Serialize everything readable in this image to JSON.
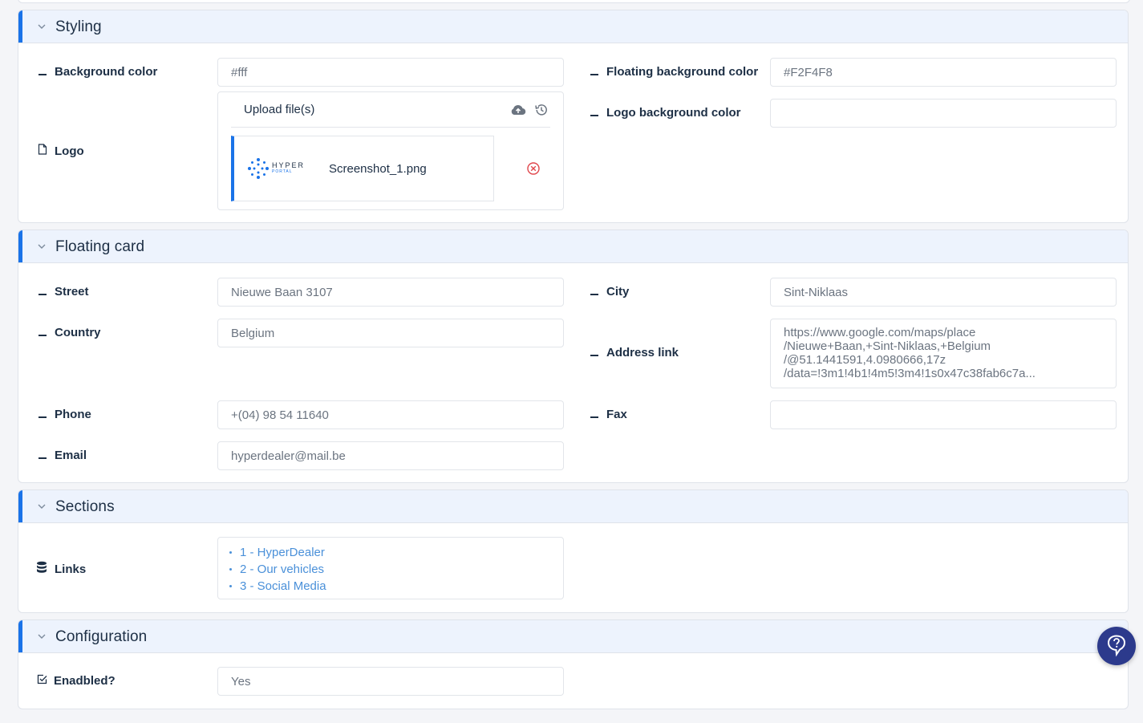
{
  "sections": {
    "styling": {
      "title": "Styling",
      "background_color": {
        "label": "Background color",
        "value": "#fff"
      },
      "floating_background_color": {
        "label": "Floating background color",
        "value": "#F2F4F8"
      },
      "logo_background_color": {
        "label": "Logo background color",
        "value": ""
      },
      "logo": {
        "label": "Logo",
        "upload_label": "Upload file(s)",
        "file_name": "Screenshot_1.png",
        "thumbnail_text": "HYPER",
        "thumbnail_subtext": "PORTAL"
      }
    },
    "floating_card": {
      "title": "Floating card",
      "street": {
        "label": "Street",
        "value": "Nieuwe Baan 3107"
      },
      "city": {
        "label": "City",
        "value": "Sint-Niklaas"
      },
      "country": {
        "label": "Country",
        "value": "Belgium"
      },
      "address_link": {
        "label": "Address link",
        "lines": [
          "https://www.google.com/maps/place",
          "/Nieuwe+Baan,+Sint-Niklaas,+Belgium",
          "/@51.1441591,4.0980666,17z",
          "/data=!3m1!4b1!4m5!3m4!1s0x47c38fab6c7a..."
        ]
      },
      "phone": {
        "label": "Phone",
        "value": "+(04) 98 54 11640"
      },
      "fax": {
        "label": "Fax",
        "value": ""
      },
      "email": {
        "label": "Email",
        "value": "hyperdealer@mail.be"
      }
    },
    "sections": {
      "title": "Sections",
      "links": {
        "label": "Links",
        "items": [
          "1 - HyperDealer",
          "2 - Our vehicles",
          "3 - Social Media"
        ]
      }
    },
    "configuration": {
      "title": "Configuration",
      "enabled": {
        "label": "Enadbled?",
        "value": "Yes"
      }
    }
  },
  "colors": {
    "accent": "#1a73e8",
    "header_bg": "#edf3fd",
    "link": "#4a90d9",
    "help_button": "#2c3a8c",
    "remove": "#e0474c"
  }
}
